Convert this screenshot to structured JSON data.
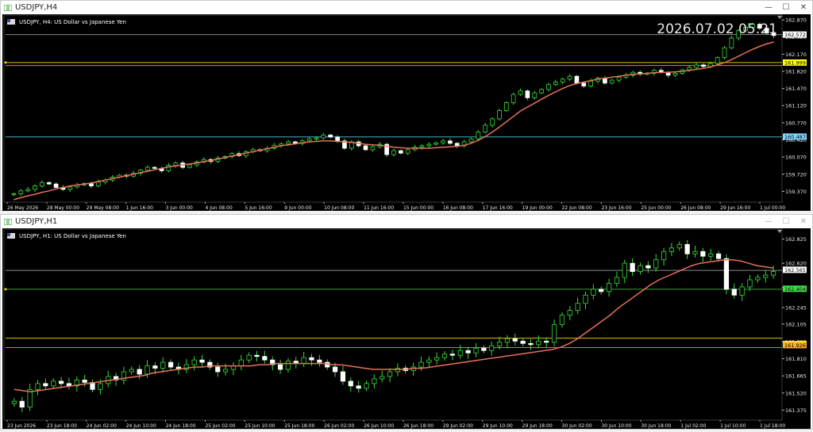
{
  "charts": [
    {
      "window_title": "USDJPY,H4",
      "info": "USDJPY, H4:  US Dollar vs Japanese Yen",
      "clock": "2026.07.02 05:21",
      "price_ticks": [
        "162.870",
        "162.520",
        "162.170",
        "161.820",
        "161.470",
        "161.120",
        "160.770",
        "160.420",
        "160.070",
        "159.720",
        "159.370"
      ],
      "price_range": [
        159.15,
        162.92
      ],
      "time_labels": [
        "26 May 2026",
        "28 May 00:00",
        "29 May 08:00",
        "1 Jun 16:00",
        "3 Jun 00:00",
        "4 Jun 08:00",
        "5 Jun 16:00",
        "9 Jun 00:00",
        "10 Jun 08:00",
        "11 Jun 16:00",
        "15 Jun 00:00",
        "16 Jun 08:00",
        "17 Jun 16:00",
        "19 Jun 00:00",
        "22 Jun 08:00",
        "23 Jun 16:00",
        "25 Jun 00:00",
        "26 Jun 08:00",
        "29 Jun 16:00",
        "1 Jul 00:00"
      ],
      "levels": [
        {
          "price": 162.57,
          "label": "162.572",
          "color": "#ffffff",
          "text": "#000000"
        },
        {
          "price": 161.999,
          "label": "161.999",
          "color": "#ffff00",
          "text": "#000000"
        },
        {
          "price": 160.487,
          "label": "160.487",
          "color": "#7fd8ff",
          "text": "#000000"
        }
      ],
      "level_lines": [
        {
          "price": 162.57,
          "color": "#8a8a8a"
        },
        {
          "price": 161.999,
          "color": "#e0c000"
        },
        {
          "price": 161.94,
          "color": "#c8a000"
        },
        {
          "price": 160.48,
          "color": "#4ab0c8"
        }
      ],
      "close_series": [
        159.32,
        159.38,
        159.41,
        159.48,
        159.55,
        159.52,
        159.45,
        159.41,
        159.46,
        159.5,
        159.53,
        159.48,
        159.56,
        159.6,
        159.66,
        159.7,
        159.68,
        159.74,
        159.8,
        159.86,
        159.84,
        159.79,
        159.9,
        159.95,
        159.86,
        159.91,
        159.97,
        160.02,
        159.98,
        160.05,
        160.08,
        160.14,
        160.1,
        160.18,
        160.22,
        160.2,
        160.25,
        160.31,
        160.34,
        160.38,
        160.35,
        160.4,
        160.44,
        160.46,
        160.52,
        160.48,
        160.4,
        160.25,
        160.38,
        160.3,
        160.22,
        160.28,
        160.33,
        160.12,
        160.2,
        160.15,
        160.22,
        160.27,
        160.3,
        160.33,
        160.36,
        160.4,
        160.35,
        160.3,
        160.38,
        160.44,
        160.58,
        160.72,
        160.85,
        161.02,
        161.18,
        161.35,
        161.42,
        161.28,
        161.38,
        161.45,
        161.55,
        161.6,
        161.66,
        161.72,
        161.58,
        161.52,
        161.62,
        161.68,
        161.58,
        161.64,
        161.7,
        161.74,
        161.8,
        161.76,
        161.78,
        161.84,
        161.8,
        161.74,
        161.78,
        161.85,
        161.9,
        161.95,
        161.92,
        161.98,
        162.1,
        162.3,
        162.5,
        162.65,
        162.72,
        162.78,
        162.7,
        162.6,
        162.55
      ],
      "ma_series": [
        159.2,
        159.24,
        159.28,
        159.31,
        159.35,
        159.38,
        159.42,
        159.45,
        159.48,
        159.5,
        159.52,
        159.54,
        159.57,
        159.6,
        159.63,
        159.66,
        159.69,
        159.72,
        159.75,
        159.78,
        159.81,
        159.84,
        159.87,
        159.89,
        159.91,
        159.93,
        159.95,
        159.98,
        160.0,
        160.03,
        160.06,
        160.09,
        160.12,
        160.15,
        160.18,
        160.21,
        160.24,
        160.27,
        160.3,
        160.32,
        160.34,
        160.36,
        160.38,
        160.39,
        160.4,
        160.4,
        160.39,
        160.38,
        160.37,
        160.35,
        160.33,
        160.32,
        160.31,
        160.29,
        160.27,
        160.26,
        160.25,
        160.25,
        160.25,
        160.25,
        160.26,
        160.27,
        160.28,
        160.29,
        160.31,
        160.35,
        160.41,
        160.49,
        160.58,
        160.68,
        160.79,
        160.9,
        161.01,
        161.09,
        161.17,
        161.25,
        161.33,
        161.4,
        161.47,
        161.53,
        161.57,
        161.6,
        161.63,
        161.66,
        161.68,
        161.7,
        161.72,
        161.74,
        161.76,
        161.77,
        161.78,
        161.79,
        161.8,
        161.8,
        161.81,
        161.82,
        161.84,
        161.86,
        161.88,
        161.91,
        161.95,
        162.0,
        162.06,
        162.13,
        162.2,
        162.27,
        162.33,
        162.38,
        162.42
      ]
    },
    {
      "window_title": "USDJPY,H1",
      "info": "USDJPY, H1:  US Dollar vs Japanese Yen",
      "price_ticks": [
        "162.825",
        "162.620",
        "162.415",
        "162.245",
        "162.105",
        "161.955",
        "161.810",
        "161.665",
        "161.520",
        "161.375"
      ],
      "price_range": [
        161.29,
        162.89
      ],
      "time_labels": [
        "23 Jun 2026",
        "23 Jun 18:00",
        "24 Jun 02:00",
        "24 Jun 10:00",
        "24 Jun 18:00",
        "25 Jun 02:00",
        "25 Jun 10:00",
        "25 Jun 18:00",
        "26 Jun 02:00",
        "26 Jun 10:00",
        "26 Jun 18:00",
        "29 Jun 02:00",
        "29 Jun 10:00",
        "29 Jun 18:00",
        "30 Jun 02:00",
        "30 Jun 10:00",
        "30 Jun 18:00",
        "1 Jul 02:00",
        "1 Jul 10:00",
        "1 Jul 18:00"
      ],
      "levels": [
        {
          "price": 162.565,
          "label": "162.565",
          "color": "#ffffff",
          "text": "#000000"
        },
        {
          "price": 162.404,
          "label": "162.404",
          "color": "#44dd44",
          "text": "#000000"
        },
        {
          "price": 161.935,
          "label": "161.935",
          "color": "#ffff00",
          "text": "#000000"
        },
        {
          "price": 161.926,
          "label": "161.926",
          "color": "#ffb030",
          "text": "#000000"
        }
      ],
      "level_lines": [
        {
          "price": 162.56,
          "color": "#8a8a8a"
        },
        {
          "price": 162.4,
          "color": "#3c9c3c"
        },
        {
          "price": 161.985,
          "color": "#e0c000"
        },
        {
          "price": 161.905,
          "color": "#c88800"
        }
      ],
      "close_series": [
        161.45,
        161.4,
        161.55,
        161.6,
        161.58,
        161.62,
        161.6,
        161.58,
        161.63,
        161.61,
        161.55,
        161.6,
        161.66,
        161.63,
        161.7,
        161.72,
        161.68,
        161.75,
        161.73,
        161.78,
        161.74,
        161.72,
        161.76,
        161.8,
        161.78,
        161.74,
        161.7,
        161.72,
        161.75,
        161.8,
        161.84,
        161.83,
        161.8,
        161.76,
        161.72,
        161.79,
        161.77,
        161.82,
        161.8,
        161.78,
        161.74,
        161.7,
        161.62,
        161.58,
        161.56,
        161.6,
        161.64,
        161.66,
        161.7,
        161.73,
        161.71,
        161.74,
        161.78,
        161.8,
        161.82,
        161.85,
        161.84,
        161.88,
        161.86,
        161.9,
        161.88,
        161.92,
        161.95,
        161.98,
        161.96,
        161.94,
        161.93,
        161.96,
        161.95,
        162.1,
        162.18,
        162.22,
        162.28,
        162.35,
        162.4,
        162.38,
        162.45,
        162.5,
        162.62,
        162.55,
        162.6,
        162.58,
        162.65,
        162.72,
        162.75,
        162.78,
        162.7,
        162.72,
        162.68,
        162.7,
        162.66,
        162.4,
        162.35,
        162.42,
        162.48,
        162.5,
        162.52,
        162.55
      ],
      "ma_series": [
        161.55,
        161.54,
        161.53,
        161.54,
        161.55,
        161.56,
        161.57,
        161.58,
        161.59,
        161.6,
        161.61,
        161.62,
        161.63,
        161.64,
        161.65,
        161.66,
        161.67,
        161.69,
        161.7,
        161.71,
        161.72,
        161.73,
        161.74,
        161.74,
        161.75,
        161.75,
        161.75,
        161.75,
        161.75,
        161.75,
        161.76,
        161.76,
        161.77,
        161.77,
        161.77,
        161.77,
        161.77,
        161.77,
        161.77,
        161.76,
        161.76,
        161.75,
        161.74,
        161.73,
        161.72,
        161.72,
        161.72,
        161.72,
        161.72,
        161.73,
        161.73,
        161.74,
        161.75,
        161.76,
        161.77,
        161.78,
        161.79,
        161.8,
        161.81,
        161.82,
        161.83,
        161.84,
        161.85,
        161.86,
        161.87,
        161.88,
        161.89,
        161.91,
        161.94,
        161.98,
        162.03,
        162.08,
        162.13,
        162.18,
        162.24,
        162.29,
        162.34,
        162.39,
        162.44,
        162.48,
        162.51,
        162.54,
        162.57,
        162.6,
        162.62,
        162.63,
        162.64,
        162.65,
        162.65,
        162.64,
        162.62,
        162.6,
        162.59,
        162.58
      ]
    }
  ]
}
